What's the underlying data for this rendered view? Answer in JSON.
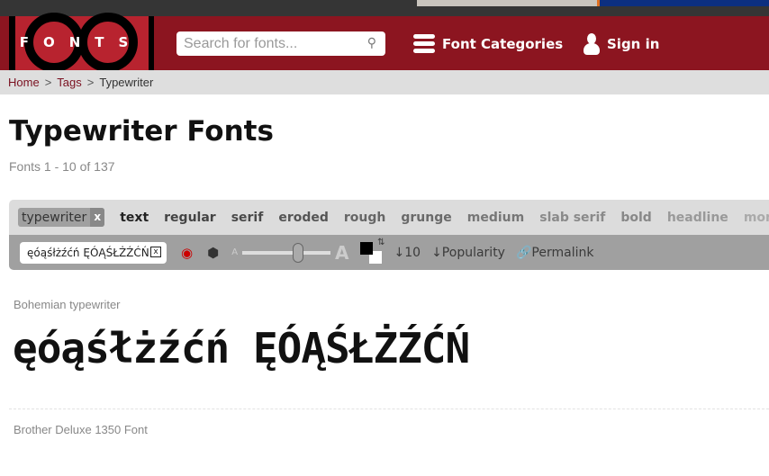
{
  "header": {
    "logo_text": "FONTS",
    "search_placeholder": "Search for fonts...",
    "categories_label": "Font Categories",
    "signin_label": "Sign in"
  },
  "breadcrumb": {
    "home": "Home",
    "tags": "Tags",
    "current": "Typewriter",
    "separator": ">"
  },
  "page": {
    "title": "Typewriter Fonts",
    "count": "Fonts 1 - 10 of 137"
  },
  "tags": {
    "active": "typewriter",
    "remove": "x",
    "items": [
      {
        "label": "text",
        "color": "#222222"
      },
      {
        "label": "regular",
        "color": "#444444"
      },
      {
        "label": "serif",
        "color": "#4a4a4a"
      },
      {
        "label": "eroded",
        "color": "#555555"
      },
      {
        "label": "rough",
        "color": "#666666"
      },
      {
        "label": "grunge",
        "color": "#6a6a6a"
      },
      {
        "label": "medium",
        "color": "#777777"
      },
      {
        "label": "slab serif",
        "color": "#8a8a8a"
      },
      {
        "label": "bold",
        "color": "#888888"
      },
      {
        "label": "headline",
        "color": "#999999"
      },
      {
        "label": "mono",
        "color": "#aaaaaa"
      }
    ]
  },
  "toolbar": {
    "sample_text": "ęóąśłżźćń ĘÓĄŚŁŻŹĆŃ",
    "clear": "x",
    "size_small": "A",
    "size_large": "A",
    "size_value": 0.65,
    "count_label": "↓10",
    "sort_label": "↓Popularity",
    "permalink_label": "Permalink",
    "fg_color": "#000000",
    "bg_color": "#ffffff"
  },
  "fonts": [
    {
      "name": "Bohemian typewriter",
      "preview": "ęóąśłżźćń ĘÓĄŚŁŻŹĆŃ"
    },
    {
      "name": "Brother Deluxe 1350 Font"
    }
  ]
}
